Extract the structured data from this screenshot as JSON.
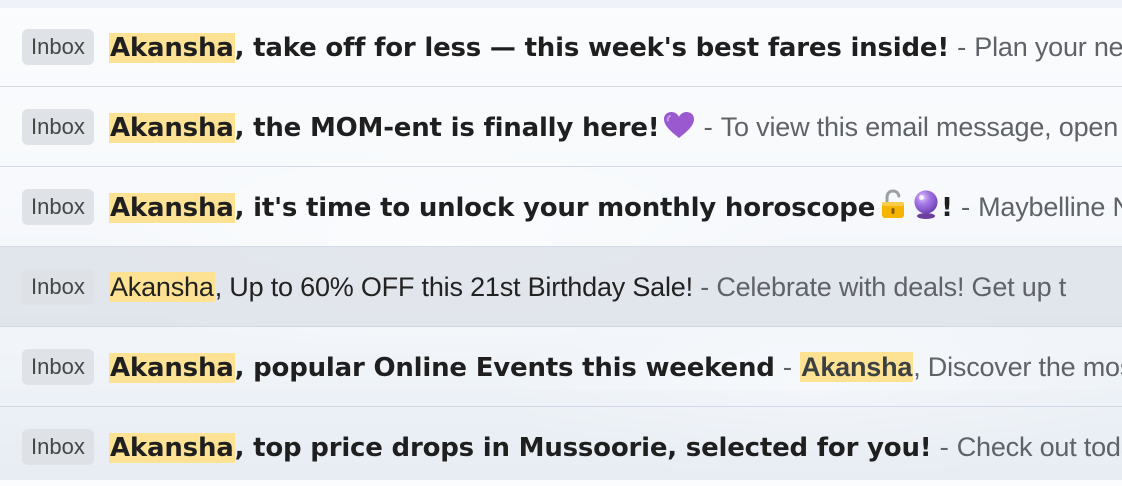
{
  "emails": [
    {
      "label": "Inbox",
      "highlight": "Akansha",
      "subject": ", take off for less — this week's best fares inside!",
      "separator": " - ",
      "snippet": "Plan your next ge",
      "unread": true
    },
    {
      "label": "Inbox",
      "highlight": "Akansha",
      "subject": ", the MOM-ent is finally here!",
      "subject_icon": "purple-heart-icon",
      "separator": " - ",
      "snippet": "To view this email message, open i",
      "unread": true
    },
    {
      "label": "Inbox",
      "highlight": "Akansha",
      "subject": ", it's time to unlock your monthly horoscope",
      "subject_icons": [
        "unlocked-padlock-icon",
        "crystal-ball-icon"
      ],
      "subject_end": "!",
      "separator": " - ",
      "snippet": "Maybelline New",
      "unread": true
    },
    {
      "label": "Inbox",
      "highlight": "Akansha",
      "subject": ", Up to 60% OFF this 21st Birthday Sale!",
      "separator": " - ",
      "snippet": "Celebrate with deals! Get up t",
      "unread": false
    },
    {
      "label": "Inbox",
      "highlight": "Akansha",
      "subject": ", popular Online Events this weekend",
      "separator": " - ",
      "snippet_highlight": "Akansha",
      "snippet": ", Discover the most #",
      "unread": true
    },
    {
      "label": "Inbox",
      "highlight": "Akansha",
      "subject": ", top price drops in Mussoorie, selected for you!",
      "separator": " - ",
      "snippet": "Check out today's",
      "unread": true
    }
  ],
  "colors": {
    "highlight": "#fde293",
    "snippet_text": "#5f6368",
    "label_chip_bg": "#dde0e5",
    "read_row_bg": "#e2e5ec",
    "heart": "#9b59d0"
  }
}
